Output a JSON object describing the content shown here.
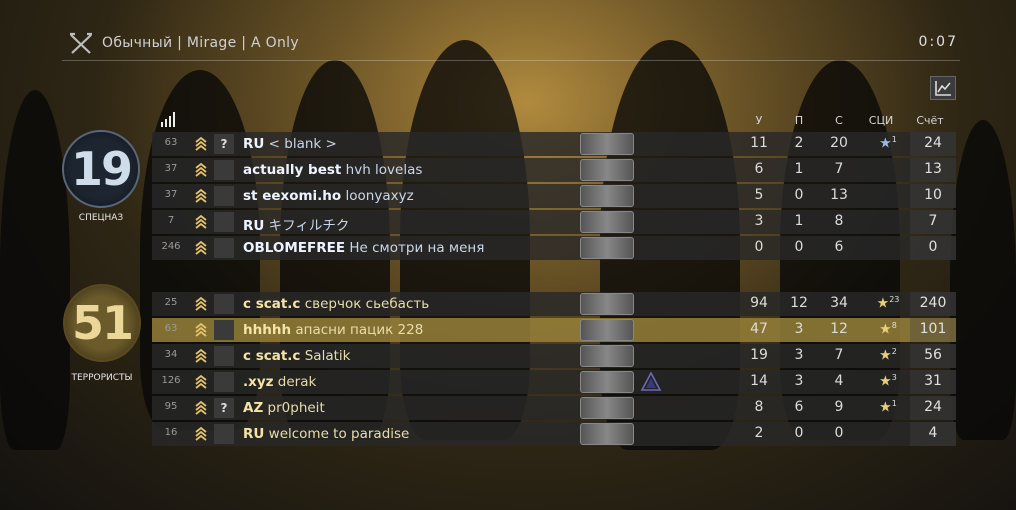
{
  "header": {
    "mode": "Обычный | Mirage | A Only",
    "timer": "0:07"
  },
  "columns": {
    "kills": "У",
    "assists": "П",
    "deaths": "С",
    "mvp": "СЦИ",
    "score": "Счёт"
  },
  "ct": {
    "score": "19",
    "name": "СПЕЦНАЗ",
    "players": [
      {
        "ping": "63",
        "avatar": "?",
        "tag": "RU",
        "name": "< blank >",
        "k": "11",
        "a": "2",
        "d": "20",
        "mvp": "★",
        "mvp_count": "1",
        "score": "24"
      },
      {
        "ping": "37",
        "avatar": "",
        "tag": "actually best",
        "name": "hvh lovelas",
        "k": "6",
        "a": "1",
        "d": "7",
        "mvp": "",
        "mvp_count": "",
        "score": "13"
      },
      {
        "ping": "37",
        "avatar": "",
        "tag": "st eexomi.ho",
        "name": "loonyaxyz",
        "k": "5",
        "a": "0",
        "d": "13",
        "mvp": "",
        "mvp_count": "",
        "score": "10"
      },
      {
        "ping": "7",
        "avatar": "",
        "tag": "RU",
        "name": "キフィルチク",
        "k": "3",
        "a": "1",
        "d": "8",
        "mvp": "",
        "mvp_count": "",
        "score": "7"
      },
      {
        "ping": "246",
        "avatar": "",
        "tag": "OBLOMEFREE",
        "name": "Не смотри на меня",
        "k": "0",
        "a": "0",
        "d": "6",
        "mvp": "",
        "mvp_count": "",
        "score": "0"
      }
    ]
  },
  "t": {
    "score": "51",
    "name": "ТЕРРОРИСТЫ",
    "players": [
      {
        "ping": "25",
        "avatar": "",
        "tag": "c scat.c",
        "name": "сверчок сьебасть",
        "k": "94",
        "a": "12",
        "d": "34",
        "mvp": "★",
        "mvp_count": "23",
        "score": "240"
      },
      {
        "ping": "63",
        "avatar": "",
        "tag": "hhhhh",
        "name": "апасни пацик 228",
        "k": "47",
        "a": "3",
        "d": "12",
        "mvp": "★",
        "mvp_count": "8",
        "score": "101"
      },
      {
        "ping": "34",
        "avatar": "",
        "tag": "c scat.c",
        "name": "Salatik",
        "k": "19",
        "a": "3",
        "d": "7",
        "mvp": "★",
        "mvp_count": "2",
        "score": "56"
      },
      {
        "ping": "126",
        "avatar": "",
        "tag": ".xyz",
        "name": "derak",
        "k": "14",
        "a": "3",
        "d": "4",
        "mvp": "★",
        "mvp_count": "3",
        "score": "31"
      },
      {
        "ping": "95",
        "avatar": "?",
        "tag": "AZ",
        "name": "pr0pheit",
        "k": "8",
        "a": "6",
        "d": "9",
        "mvp": "★",
        "mvp_count": "1",
        "score": "24"
      },
      {
        "ping": "16",
        "avatar": "",
        "tag": "RU",
        "name": "welcome to paradise",
        "k": "2",
        "a": "0",
        "d": "0",
        "mvp": "",
        "mvp_count": "",
        "score": "4"
      }
    ]
  },
  "colors": {
    "ct_accent": "#cfdcea",
    "t_accent": "#ecd79a",
    "highlight_row": "#96803a"
  },
  "icons": {
    "mode": "crossed-rifles-icon",
    "graph": "graph-icon",
    "signal": "signal-bars-icon"
  }
}
